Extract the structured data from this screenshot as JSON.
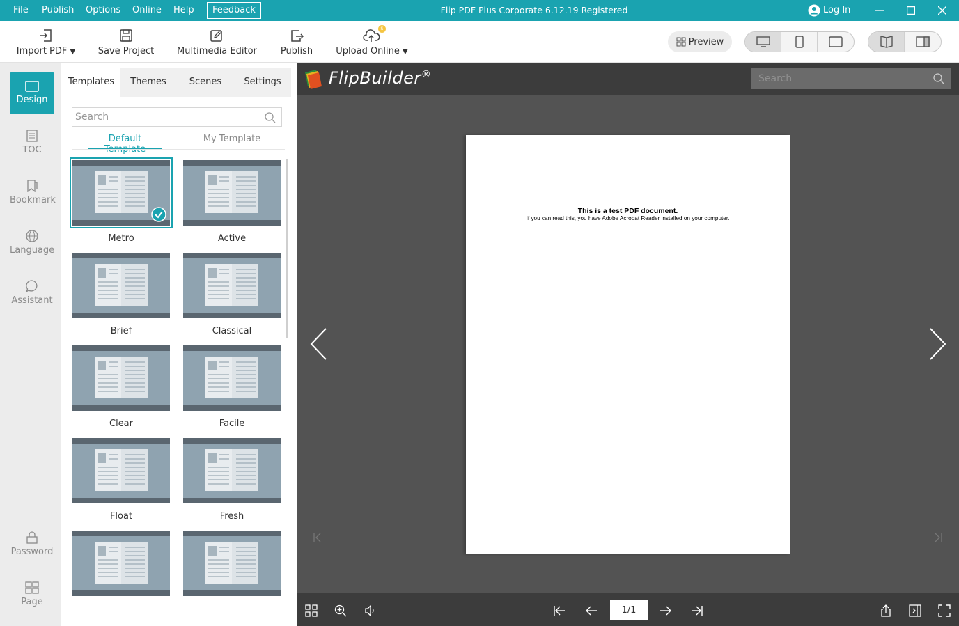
{
  "menu": {
    "file": "File",
    "publish": "Publish",
    "options": "Options",
    "online": "Online",
    "help": "Help",
    "feedback": "Feedback"
  },
  "app_title": "Flip PDF Plus Corporate 6.12.19 Registered",
  "login": "Log In",
  "toolbar": {
    "import_pdf": "Import PDF",
    "save_project": "Save Project",
    "multimedia_editor": "Multimedia Editor",
    "publish": "Publish",
    "upload_online": "Upload Online",
    "upload_badge": "$",
    "preview": "Preview"
  },
  "leftnav": {
    "design": "Design",
    "toc": "TOC",
    "bookmark": "Bookmark",
    "language": "Language",
    "assistant": "Assistant",
    "password": "Password",
    "page": "Page"
  },
  "panel": {
    "tabs": [
      "Templates",
      "Themes",
      "Scenes",
      "Settings"
    ],
    "search_placeholder": "Search",
    "subtabs": [
      "Default Template",
      "My Template"
    ],
    "templates": [
      "Metro",
      "Active",
      "Brief",
      "Classical",
      "Clear",
      "Facile",
      "Float",
      "Fresh"
    ]
  },
  "viewer": {
    "brand": "FlipBuilder",
    "brand_mark": "®",
    "search_placeholder": "Search",
    "doc_title": "This is a test PDF document.",
    "doc_body": "If you can read this, you have Adobe Acrobat Reader installed on your computer.",
    "page_indicator": "1/1"
  },
  "colors": {
    "accent": "#1aa3b0",
    "viewer_bg": "#535353",
    "viewer_bar": "#3c3c3c",
    "thumb": "#8fa3b0"
  }
}
